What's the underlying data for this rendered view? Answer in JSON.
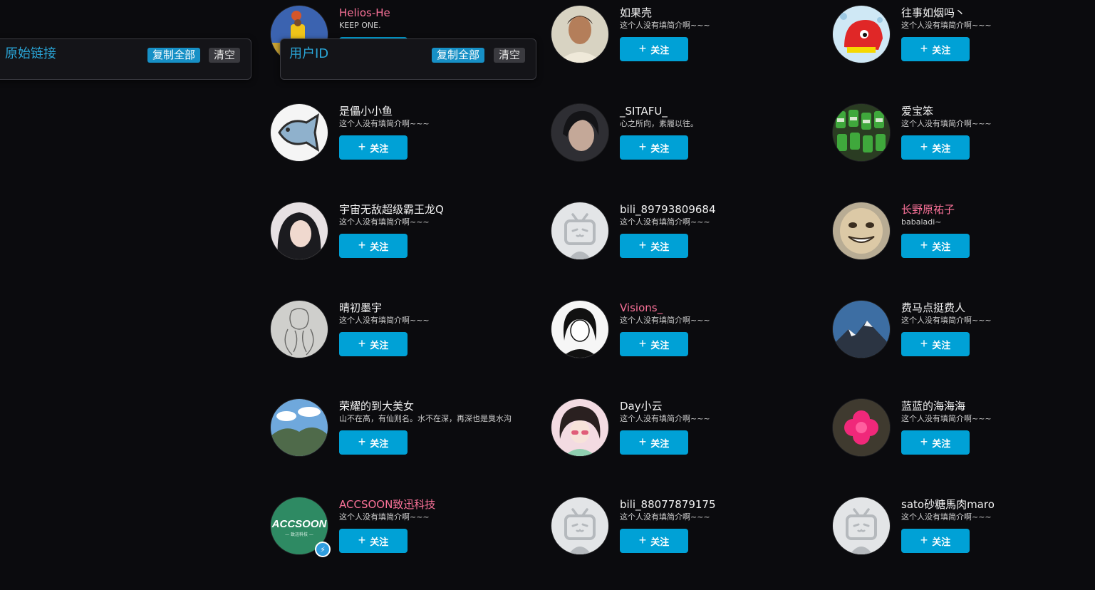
{
  "follow_label": "关注",
  "accent_color": "#00a1d6",
  "vip_name_color": "#fb7299",
  "panels": {
    "original_links": {
      "title": "原始链接",
      "copy_all": "复制全部",
      "clear": "清空"
    },
    "user_ids": {
      "title": "用户ID",
      "copy_all": "复制全部",
      "clear": "清空"
    }
  },
  "users": [
    {
      "name": "Helios-He",
      "sign": "KEEP ONE.",
      "vip": true,
      "avatar": "basketball-player-avatar"
    },
    {
      "name": "如果壳",
      "sign": "这个人没有填简介啊~~~",
      "vip": false,
      "avatar": "man-portrait-avatar"
    },
    {
      "name": "往事如烟吗丶",
      "sign": "这个人没有填简介啊~~~",
      "vip": false,
      "avatar": "red-cartoon-avatar"
    },
    {
      "name": "是儡小小鱼",
      "sign": "这个人没有填简介啊~~~",
      "vip": false,
      "avatar": "fish-drawing-avatar"
    },
    {
      "name": "_SITAFU_",
      "sign": "心之所向，素履以往。",
      "vip": false,
      "avatar": "girl-portrait-avatar"
    },
    {
      "name": "爱宝笨",
      "sign": "这个人没有填简介啊~~~",
      "vip": false,
      "avatar": "bottles-avatar"
    },
    {
      "name": "宇宙无敌超级霸王龙Q",
      "sign": "这个人没有填简介啊~~~",
      "vip": false,
      "avatar": "woman-selfie-avatar"
    },
    {
      "name": "bili_89793809684",
      "sign": "这个人没有填简介啊~~~",
      "vip": false,
      "avatar": "default-tv-avatar"
    },
    {
      "name": "长野原祐子",
      "sign": "babaladi~",
      "vip": true,
      "avatar": "funny-face-avatar"
    },
    {
      "name": "晴初墨宇",
      "sign": "这个人没有填简介啊~~~",
      "vip": false,
      "avatar": "sketch-avatar"
    },
    {
      "name": "Visions_",
      "sign": "这个人没有填简介啊~~~",
      "vip": true,
      "avatar": "anime-girl-avatar"
    },
    {
      "name": "费马点挺费人",
      "sign": "这个人没有填简介啊~~~",
      "vip": false,
      "avatar": "mountain-avatar"
    },
    {
      "name": "荣耀的到大美女",
      "sign": "山不在高，有仙则名。水不在深，再深也是臭水沟",
      "vip": false,
      "avatar": "landscape-avatar"
    },
    {
      "name": "Day小云",
      "sign": "这个人没有填简介啊~~~",
      "vip": false,
      "avatar": "illustrated-girl-avatar"
    },
    {
      "name": "蓝蓝的海海海",
      "sign": "这个人没有填简介啊~~~",
      "vip": false,
      "avatar": "pink-flower-avatar"
    },
    {
      "name": "ACCSOON致迅科技",
      "sign": "这个人没有填简介啊~~~",
      "vip": true,
      "avatar": "accsoon-logo-avatar",
      "logo_text": "ACCSOON",
      "logo_sub": "— 致迅科技 —",
      "verified": true
    },
    {
      "name": "bili_88077879175",
      "sign": "这个人没有填简介啊~~~",
      "vip": false,
      "avatar": "default-tv-avatar"
    },
    {
      "name": "sato砂糖馬肉maro",
      "sign": "这个人没有填简介啊~~~",
      "vip": false,
      "avatar": "default-tv-avatar"
    }
  ]
}
